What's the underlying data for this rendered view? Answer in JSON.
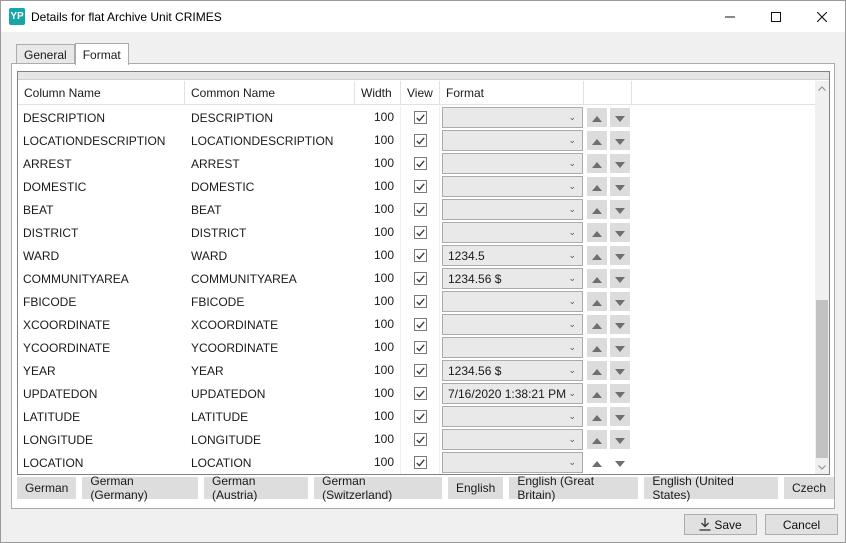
{
  "window": {
    "title": "Details for flat Archive Unit CRIMES",
    "app_icon_text": "YP"
  },
  "tabs": [
    {
      "label": "General",
      "active": false
    },
    {
      "label": "Format",
      "active": true
    }
  ],
  "grid": {
    "headers": {
      "column_name": "Column Name",
      "common_name": "Common Name",
      "width": "Width",
      "view": "View",
      "format": "Format"
    },
    "rows": [
      {
        "column_name": "DESCRIPTION",
        "common_name": "DESCRIPTION",
        "width": "100",
        "view": true,
        "format": ""
      },
      {
        "column_name": "LOCATIONDESCRIPTION",
        "common_name": "LOCATIONDESCRIPTION",
        "width": "100",
        "view": true,
        "format": ""
      },
      {
        "column_name": "ARREST",
        "common_name": "ARREST",
        "width": "100",
        "view": true,
        "format": ""
      },
      {
        "column_name": "DOMESTIC",
        "common_name": "DOMESTIC",
        "width": "100",
        "view": true,
        "format": ""
      },
      {
        "column_name": "BEAT",
        "common_name": "BEAT",
        "width": "100",
        "view": true,
        "format": ""
      },
      {
        "column_name": "DISTRICT",
        "common_name": "DISTRICT",
        "width": "100",
        "view": true,
        "format": ""
      },
      {
        "column_name": "WARD",
        "common_name": "WARD",
        "width": "100",
        "view": true,
        "format": "1234.5"
      },
      {
        "column_name": "COMMUNITYAREA",
        "common_name": "COMMUNITYAREA",
        "width": "100",
        "view": true,
        "format": "1234.56 $"
      },
      {
        "column_name": "FBICODE",
        "common_name": "FBICODE",
        "width": "100",
        "view": true,
        "format": ""
      },
      {
        "column_name": "XCOORDINATE",
        "common_name": "XCOORDINATE",
        "width": "100",
        "view": true,
        "format": ""
      },
      {
        "column_name": "YCOORDINATE",
        "common_name": "YCOORDINATE",
        "width": "100",
        "view": true,
        "format": ""
      },
      {
        "column_name": "YEAR",
        "common_name": "YEAR",
        "width": "100",
        "view": true,
        "format": "1234.56 $"
      },
      {
        "column_name": "UPDATEDON",
        "common_name": "UPDATEDON",
        "width": "100",
        "view": true,
        "format": "7/16/2020 1:38:21 PM"
      },
      {
        "column_name": "LATITUDE",
        "common_name": "LATITUDE",
        "width": "100",
        "view": true,
        "format": ""
      },
      {
        "column_name": "LONGITUDE",
        "common_name": "LONGITUDE",
        "width": "100",
        "view": true,
        "format": ""
      },
      {
        "column_name": "LOCATION",
        "common_name": "LOCATION",
        "width": "100",
        "view": true,
        "format": ""
      }
    ]
  },
  "languages": [
    "German",
    "German (Germany)",
    "German (Austria)",
    "German (Switzerland)",
    "English",
    "English (Great Britain)",
    "English (United States)",
    "Czech"
  ],
  "footer": {
    "save_label": "Save",
    "cancel_label": "Cancel"
  },
  "colors": {
    "app_icon": "#17a5a5",
    "button_face": "#e1e1e1",
    "arrow_fill": "#6f6f6f"
  }
}
